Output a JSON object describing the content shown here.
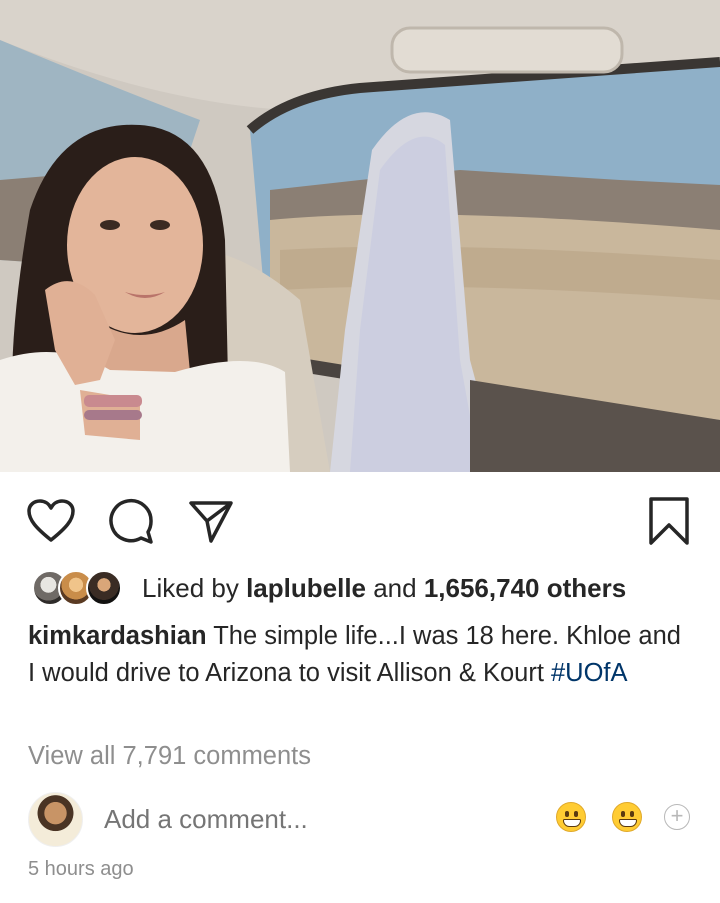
{
  "post": {
    "photo_alt": "",
    "actions": {
      "like_icon": "heart-outline-icon",
      "comment_icon": "comment-bubble-icon",
      "share_icon": "paper-plane-icon",
      "save_icon": "bookmark-icon"
    },
    "likes": {
      "prefix": "Liked by ",
      "user": "laplubelle",
      "middle": " and ",
      "count": "1,656,740 others"
    },
    "caption": {
      "username": "kimkardashian",
      "text": " The simple life...I was 18 here. Khloe and I would drive to Arizona to visit Allison & Kourt ",
      "hashtag": "#UOfA"
    },
    "view_all_comments": "View all 7,791 comments",
    "add_comment": {
      "placeholder": "Add a comment...",
      "quick_emojis": [
        "grinning-face-icon",
        "grinning-face-icon"
      ],
      "more_icon": "plus-circle-icon"
    },
    "timestamp": "5 hours ago"
  },
  "colors": {
    "text": "#262626",
    "muted": "#8e8e8e",
    "hashtag": "#003569"
  }
}
